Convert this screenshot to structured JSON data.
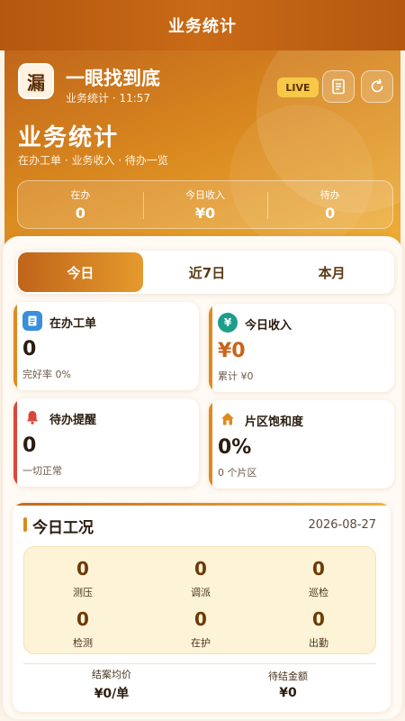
{
  "header": {
    "title": "业务统计"
  },
  "hero": {
    "logo_char": "漏",
    "app_name": "一眼找到底",
    "app_sub": "业务统计 · 11:57",
    "live_badge": "LIVE",
    "title": "业务统计",
    "subtitle": "在办工单 · 业务收入 · 待办一览",
    "stats": [
      {
        "label": "在办",
        "value": "0"
      },
      {
        "label": "今日收入",
        "value": "¥0"
      },
      {
        "label": "待办",
        "value": "0"
      }
    ]
  },
  "tabs": [
    {
      "label": "今日",
      "active": true
    },
    {
      "label": "近7日",
      "active": false
    },
    {
      "label": "本月",
      "active": false
    }
  ],
  "cards": [
    {
      "title": "在办工单",
      "value": "0",
      "note": "完好率 0%",
      "icon": "document-icon",
      "color": "#3b8fd8"
    },
    {
      "title": "今日收入",
      "value": "¥0",
      "note": "累计 ¥0",
      "icon": "yen-icon",
      "color": "#1e9e8a"
    },
    {
      "title": "待办提醒",
      "value": "0",
      "note": "一切正常",
      "icon": "bell-icon",
      "color": "#d9473a"
    },
    {
      "title": "片区饱和度",
      "value": "0%",
      "note": "0 个片区",
      "icon": "home-icon",
      "color": "#e08a1e"
    }
  ],
  "work": {
    "title": "今日工况",
    "date": "2026-08-27",
    "items": [
      {
        "label": "测压",
        "value": "0"
      },
      {
        "label": "调派",
        "value": "0"
      },
      {
        "label": "巡检",
        "value": "0"
      },
      {
        "label": "检测",
        "value": "0"
      },
      {
        "label": "在护",
        "value": "0"
      },
      {
        "label": "出勤",
        "value": "0"
      }
    ],
    "footer": [
      {
        "label": "结案均价",
        "value": "¥0/单"
      },
      {
        "label": "待结金额",
        "value": "¥0"
      }
    ]
  }
}
